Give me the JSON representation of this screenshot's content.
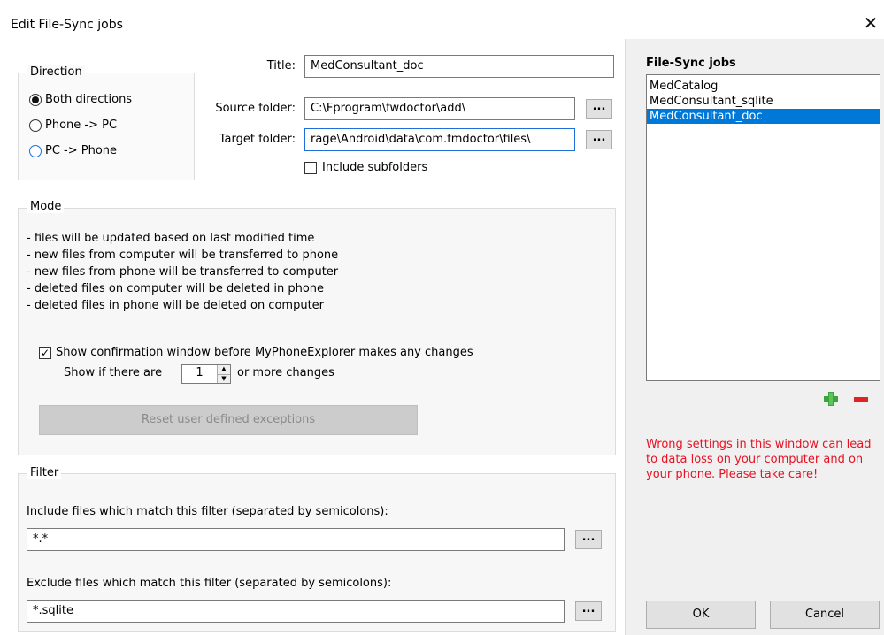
{
  "window": {
    "title": "Edit File-Sync jobs",
    "close_glyph": "✕"
  },
  "direction": {
    "legend": "Direction",
    "options": [
      {
        "label": "Both directions",
        "selected": true
      },
      {
        "label": "Phone -> PC",
        "selected": false
      },
      {
        "label": "PC -> Phone",
        "selected": false
      }
    ]
  },
  "job": {
    "title_label": "Title:",
    "title_value": "MedConsultant_doc",
    "source_label": "Source folder:",
    "source_value": "C:\\Fprogram\\fwdoctor\\add\\",
    "target_label": "Target folder:",
    "target_value": "rage\\Android\\data\\com.fmdoctor\\files\\",
    "browse_label": "...",
    "include_subfolders_label": "Include subfolders",
    "include_subfolders_checked": false
  },
  "mode": {
    "legend": "Mode",
    "lines": [
      "- files will be updated based on last modified time",
      "- new files from computer will be transferred to phone",
      "- new files from phone will be transferred to computer",
      "- deleted files on computer will be deleted in phone",
      "- deleted files in phone will be deleted on computer"
    ],
    "confirm_label": "Show confirmation window before MyPhoneExplorer makes any changes",
    "confirm_checked": true,
    "show_if_prefix": "Show if there are",
    "threshold_value": "1",
    "show_if_suffix": "or more changes",
    "reset_button": "Reset user defined exceptions"
  },
  "filter": {
    "legend": "Filter",
    "include_label": "Include files which match this filter (separated by semicolons):",
    "include_value": "*.*",
    "exclude_label": "Exclude files which match this filter (separated by semicolons):",
    "exclude_value": "*.sqlite",
    "browse_label": "..."
  },
  "sidebar": {
    "heading": "File-Sync jobs",
    "jobs": [
      "MedCatalog",
      "MedConsultant_sqlite",
      "MedConsultant_doc"
    ],
    "selected_index": 2,
    "add_icon_color": "#3aa53a",
    "remove_icon_color": "#e02424",
    "warning": "Wrong settings in this window can lead to data loss on your computer and on your phone. Please take care!",
    "warning_color": "#e81123",
    "ok_button": "OK",
    "cancel_button": "Cancel"
  },
  "colors": {
    "selection": "#0078d7",
    "focus_border": "#1e6fd9"
  }
}
